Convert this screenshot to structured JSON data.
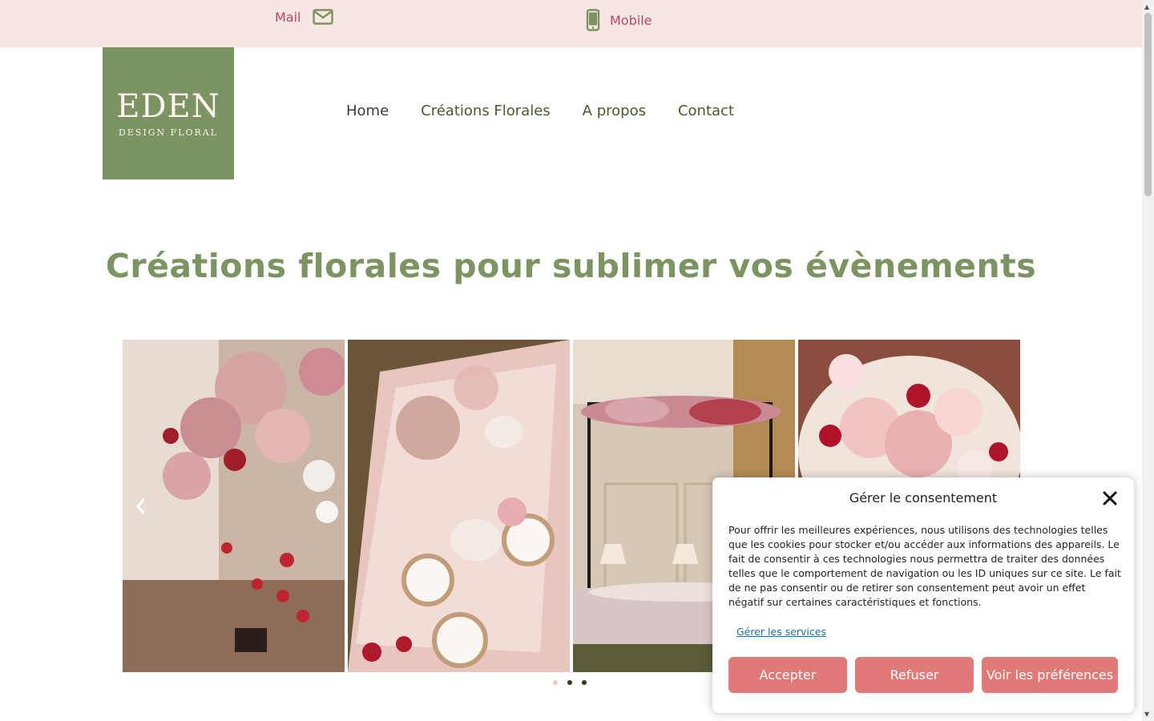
{
  "topbar": {
    "mail_label": "Mail",
    "mobile_label": "Mobile",
    "mail_icon": "envelope-icon",
    "mobile_icon": "phone-icon"
  },
  "logo": {
    "brand": "EDEN",
    "tagline": "DESIGN FLORAL"
  },
  "nav": {
    "items": [
      "Home",
      "Créations Florales",
      "A propos",
      "Contact"
    ]
  },
  "hero": {
    "title": "Créations florales pour sublimer vos évènements"
  },
  "carousel": {
    "slides": [
      "hanging-floral-installation",
      "floral-table-setting",
      "floral-arch-dining-room",
      "floral-bouquet-closeup"
    ],
    "prev_icon": "chevron-left-icon",
    "dot_count": 3,
    "active_dot": 0
  },
  "consent": {
    "title": "Gérer le consentement",
    "body": "Pour offrir les meilleures expériences, nous utilisons des technologies telles que les cookies pour stocker et/ou accéder aux informations des appareils. Le fait de consentir à ces technologies nous permettra de traiter des données telles que le comportement de navigation ou les ID uniques sur ce site. Le fait de ne pas consentir ou de retirer son consentement peut avoir un effet négatif sur certaines caractéristiques et fonctions.",
    "manage_services": "Gérer les services",
    "accept": "Accepter",
    "refuse": "Refuser",
    "preferences": "Voir les préférences",
    "close_icon": "close-icon"
  },
  "colors": {
    "topbar_bg": "#f8e6e4",
    "accent_pink": "#b5485f",
    "brand_green": "#7b9461",
    "nav_text": "#4b5a2e",
    "button_bg": "#e07a77"
  }
}
